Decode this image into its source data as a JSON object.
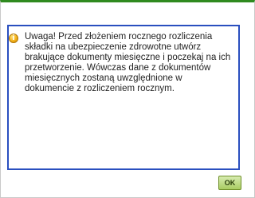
{
  "dialog": {
    "message": "Uwaga! Przed złożeniem rocznego rozliczenia składki na ubezpieczenie zdrowotne utwórz brakujące dokumenty miesięczne i poczekaj na ich przetworzenie. Wówczas dane z dokumentów miesięcznych zostaną uwzględnione w dokumencie z rozliczeniem rocznym.",
    "icon": "info-icon",
    "icon_glyph": "i",
    "ok_label": "OK"
  },
  "colors": {
    "accent": "#2f8a1f",
    "focus_border": "#2a4fbf",
    "button": "#a9cc62"
  }
}
